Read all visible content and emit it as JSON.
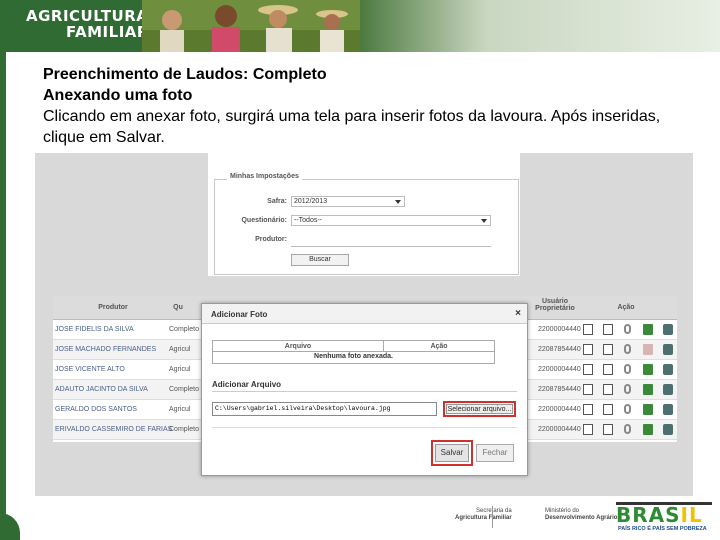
{
  "banner": {
    "logo_line1": "AGRICULTURA",
    "logo_line2": "FAMILIAR"
  },
  "intro": {
    "title": "Preenchimento de Laudos: Completo",
    "subtitle": "Anexando uma foto",
    "body": "Clicando em anexar foto, surgirá uma tela para inserir fotos da lavoura. Após inseridas, clique em Salvar."
  },
  "form": {
    "legend": "Minhas Impostações",
    "safra_label": "Safra:",
    "safra_value": "2012/2013",
    "questionario_label": "Questionário:",
    "questionario_value": "--Todos--",
    "produtor_label": "Produtor:",
    "buscar_label": "Buscar"
  },
  "table": {
    "headers": {
      "produtor": "Produtor",
      "questionario": "Qu",
      "usuario": "Usuário Proprietário",
      "acao": "Ação"
    },
    "rows": [
      {
        "name": "JOSE FIDELIS DA SILVA",
        "q": "Completo",
        "id": "22000004440"
      },
      {
        "name": "JOSE MACHADO FERNANDES",
        "q": "Agricul",
        "id": "22087854440"
      },
      {
        "name": "JOSE VICENTE ALTO",
        "q": "Agricul",
        "id": "22000004440"
      },
      {
        "name": "ADAUTO JACINTO DA SILVA",
        "q": "Completo",
        "id": "22087854440"
      },
      {
        "name": "GERALDO DOS SANTOS",
        "q": "Agricul",
        "id": "22000004440"
      },
      {
        "name": "ERIVALDO CASSEMIRO DE FARIAS",
        "q": "Completo",
        "id": "22000004440"
      }
    ]
  },
  "modal": {
    "title": "Adicionar Foto",
    "close": "×",
    "col_arquivo": "Arquivo",
    "col_acao": "Ação",
    "empty_text": "Nenhuma foto anexada.",
    "section_label": "Adicionar Arquivo",
    "file_path": "C:\\Users\\gabriel.silveira\\Desktop\\lavoura.jpg",
    "browse_label": "Selecionar arquivo...",
    "save_label": "Salvar",
    "close_label": "Fechar"
  },
  "footer": {
    "sec_line1": "Secretaria da",
    "sec_line2": "Agricultura Familiar",
    "min_line1": "Ministério do",
    "min_line2": "Desenvolvimento Agrário",
    "brasil_word_a": "BRAS",
    "brasil_word_b": "IL",
    "brasil_tag": "PAÍS RICO É PAÍS SEM POBREZA"
  },
  "colors": {
    "brand_green": "#2f6b33",
    "highlight_red": "#d03030"
  }
}
